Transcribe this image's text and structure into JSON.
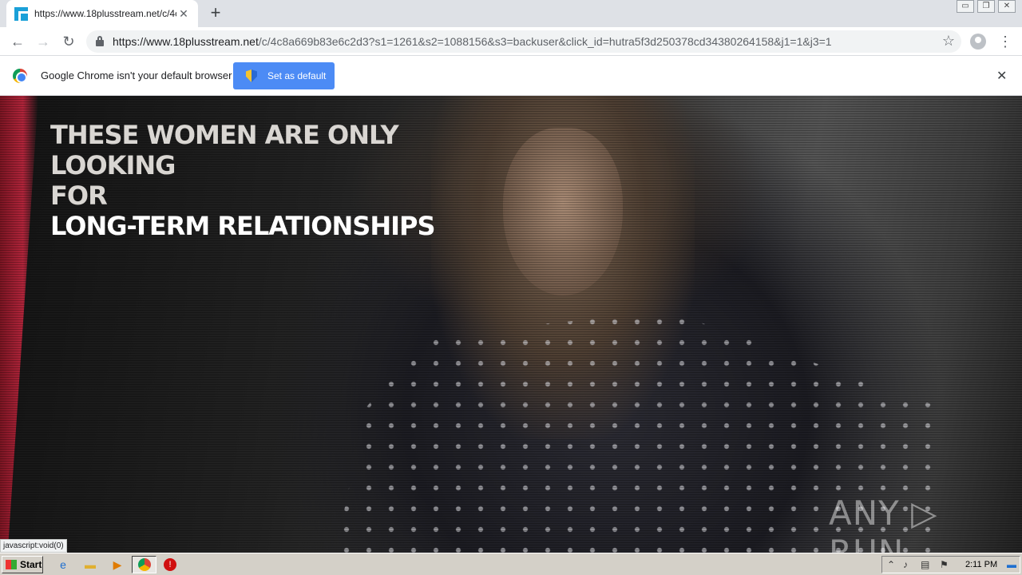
{
  "browser": {
    "tab": {
      "title": "https://www.18plusstream.net/c/4c",
      "close_glyph": "✕",
      "favicon": "square-logo-icon"
    },
    "new_tab_glyph": "+",
    "window_controls": [
      "▭",
      "❐",
      "✕"
    ],
    "nav": {
      "back_glyph": "←",
      "forward_glyph": "→",
      "reload_glyph": "↻"
    },
    "url": {
      "host": "https://www.18plusstream.net",
      "path": "/c/4c8a669b83e6c2d3?s1=1261&s2=1088156&s3=backuser&click_id=hutra5f3d250378cd34380264158&j1=1&j3=1"
    },
    "bookmark_glyph": "☆",
    "menu_glyph": "⋮"
  },
  "infobar": {
    "message": "Google Chrome isn't your default browser",
    "button_label": "Set as default",
    "close_glyph": "✕"
  },
  "page": {
    "headline_line1": "THESE WOMEN ARE ONLY LOOKING",
    "headline_line2": "FOR",
    "headline_line3": "LONG-TERM RELATIONSHIPS",
    "watermark": "ANY ▷ RUN"
  },
  "status_bar": {
    "text": "javascript:void(0)"
  },
  "taskbar": {
    "start_label": "Start",
    "clock": "2:11 PM",
    "apps": [
      "ie-icon",
      "folder-icon",
      "media-player-icon",
      "chrome-icon",
      "stop-icon"
    ]
  }
}
